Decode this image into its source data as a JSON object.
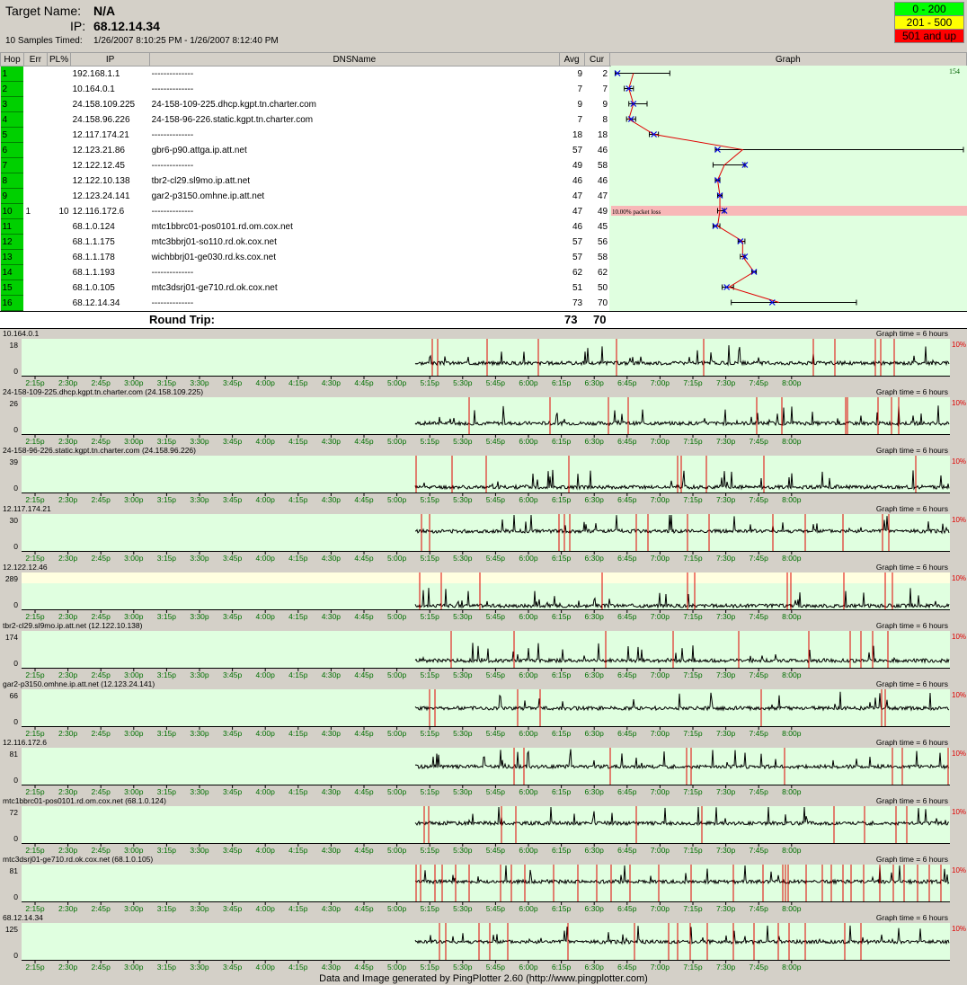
{
  "header": {
    "target_label": "Target Name:",
    "target_value": "N/A",
    "ip_label": "IP:",
    "ip_value": "68.12.14.34",
    "samples_label": "10 Samples Timed:",
    "samples_range": "1/26/2007 8:10:25 PM - 1/26/2007 8:12:40 PM"
  },
  "legend": [
    {
      "label": "0 - 200",
      "color": "#00ff00",
      "text_color": "#000000"
    },
    {
      "label": "201 - 500",
      "color": "#ffff00",
      "text_color": "#000000"
    },
    {
      "label": "501 and up",
      "color": "#ff0000",
      "text_color": "#000000"
    }
  ],
  "columns": {
    "hop": "Hop",
    "err": "Err",
    "pl": "PL%",
    "ip": "IP",
    "dns": "DNSName",
    "avg": "Avg",
    "cur": "Cur",
    "graph": "Graph"
  },
  "route_graph": {
    "max_label": "154",
    "packet_loss_note": "10.00% packet loss",
    "xmax": 154
  },
  "hops": [
    {
      "hop": "1",
      "err": "",
      "pl": "",
      "ip": "192.168.1.1",
      "dns": "--------------",
      "avg": "9",
      "cur": "2",
      "min": 1,
      "max": 25
    },
    {
      "hop": "2",
      "err": "",
      "pl": "",
      "ip": "10.164.0.1",
      "dns": "--------------",
      "avg": "7",
      "cur": "7",
      "min": 5,
      "max": 9
    },
    {
      "hop": "3",
      "err": "",
      "pl": "",
      "ip": "24.158.109.225",
      "dns": "24-158-109-225.dhcp.kgpt.tn.charter.com",
      "avg": "9",
      "cur": "9",
      "min": 7,
      "max": 15
    },
    {
      "hop": "4",
      "err": "",
      "pl": "",
      "ip": "24.158.96.226",
      "dns": "24-158-96-226.static.kgpt.tn.charter.com",
      "avg": "7",
      "cur": "8",
      "min": 6,
      "max": 10
    },
    {
      "hop": "5",
      "err": "",
      "pl": "",
      "ip": "12.117.174.21",
      "dns": "--------------",
      "avg": "18",
      "cur": "18",
      "min": 16,
      "max": 20
    },
    {
      "hop": "6",
      "err": "",
      "pl": "",
      "ip": "12.123.21.86",
      "dns": "gbr6-p90.attga.ip.att.net",
      "avg": "57",
      "cur": "46",
      "min": 45,
      "max": 154
    },
    {
      "hop": "7",
      "err": "",
      "pl": "",
      "ip": "12.122.12.45",
      "dns": "--------------",
      "avg": "49",
      "cur": "58",
      "min": 44,
      "max": 58
    },
    {
      "hop": "8",
      "err": "",
      "pl": "",
      "ip": "12.122.10.138",
      "dns": "tbr2-cl29.sl9mo.ip.att.net",
      "avg": "46",
      "cur": "46",
      "min": 45,
      "max": 47
    },
    {
      "hop": "9",
      "err": "",
      "pl": "",
      "ip": "12.123.24.141",
      "dns": "gar2-p3150.omhne.ip.att.net",
      "avg": "47",
      "cur": "47",
      "min": 46,
      "max": 48
    },
    {
      "hop": "10",
      "err": "1",
      "pl": "10",
      "ip": "12.116.172.6",
      "dns": "--------------",
      "avg": "47",
      "cur": "49",
      "min": 46,
      "max": 49
    },
    {
      "hop": "11",
      "err": "",
      "pl": "",
      "ip": "68.1.0.124",
      "dns": "mtc1bbrc01-pos0101.rd.om.cox.net",
      "avg": "46",
      "cur": "45",
      "min": 44,
      "max": 47
    },
    {
      "hop": "12",
      "err": "",
      "pl": "",
      "ip": "68.1.1.175",
      "dns": "mtc3bbrj01-so110.rd.ok.cox.net",
      "avg": "57",
      "cur": "56",
      "min": 55,
      "max": 58
    },
    {
      "hop": "13",
      "err": "",
      "pl": "",
      "ip": "68.1.1.178",
      "dns": "wichbbrj01-ge030.rd.ks.cox.net",
      "avg": "57",
      "cur": "58",
      "min": 56,
      "max": 58
    },
    {
      "hop": "14",
      "err": "",
      "pl": "",
      "ip": "68.1.1.193",
      "dns": "--------------",
      "avg": "62",
      "cur": "62",
      "min": 61,
      "max": 63
    },
    {
      "hop": "15",
      "err": "",
      "pl": "",
      "ip": "68.1.0.105",
      "dns": "mtc3dsrj01-ge710.rd.ok.cox.net",
      "avg": "51",
      "cur": "50",
      "min": 48,
      "max": 53
    },
    {
      "hop": "16",
      "err": "",
      "pl": "",
      "ip": "68.12.14.34",
      "dns": "--------------",
      "avg": "73",
      "cur": "70",
      "min": 52,
      "max": 107
    }
  ],
  "round_trip": {
    "label": "Round Trip:",
    "avg": "73",
    "cur": "70"
  },
  "time_axis": [
    "2:15p",
    "2:30p",
    "2:45p",
    "3:00p",
    "3:15p",
    "3:30p",
    "3:45p",
    "4:00p",
    "4:15p",
    "4:30p",
    "4:45p",
    "5:00p",
    "5:15p",
    "5:30p",
    "5:45p",
    "6:00p",
    "6:15p",
    "6:30p",
    "6:45p",
    "7:00p",
    "7:15p",
    "7:30p",
    "7:45p",
    "8:00p"
  ],
  "graph_time_label": "Graph time = 6 hours",
  "loss_scale_label": "10%",
  "timelines": [
    {
      "title": "10.164.0.1",
      "max": "18",
      "min": "0",
      "base": 0.3,
      "seed": 3,
      "loss": [
        481,
        487,
        542,
        599,
        686,
        783,
        905,
        929,
        974,
        980,
        995
      ]
    },
    {
      "title": "24-158-109-225.dhcp.kgpt.tn.charter.com (24.158.109.225)",
      "max": "26",
      "min": "0",
      "base": 0.25,
      "seed": 7,
      "loss": [
        522,
        612,
        677,
        699,
        842,
        870,
        941,
        943,
        977,
        992,
        1000
      ]
    },
    {
      "title": "24-158-96-226.static.kgpt.tn.charter.com (24.158.96.226)",
      "max": "39",
      "min": "0",
      "base": 0.1,
      "seed": 11,
      "loss": [
        463,
        503,
        541,
        633,
        754,
        758,
        786,
        850,
        1019
      ]
    },
    {
      "title": "12.117.174.21",
      "max": "30",
      "min": "0",
      "base": 0.5,
      "seed": 13,
      "loss": [
        469,
        478,
        622,
        628,
        634,
        708,
        721,
        765,
        789,
        860,
        896,
        938,
        982,
        989
      ]
    },
    {
      "title": "12.122.12.46",
      "max": "289",
      "min": "0",
      "base": 0.05,
      "seed": 17,
      "loss": [
        467,
        491,
        534,
        670,
        765,
        773,
        876,
        880,
        939,
        985,
        993
      ],
      "yellow_top": true
    },
    {
      "title": "tbr2-cl29.sl9mo.ip.att.net (12.122.10.138)",
      "max": "174",
      "min": "0",
      "base": 0.15,
      "seed": 19,
      "loss": [
        502,
        572,
        674,
        749,
        822,
        900,
        946,
        958,
        971,
        988
      ]
    },
    {
      "title": "gar2-p3150.omhne.ip.att.net (12.123.24.141)",
      "max": "66",
      "min": "0",
      "base": 0.45,
      "seed": 23,
      "loss": [
        478,
        484,
        576,
        601,
        847,
        981,
        985
      ]
    },
    {
      "title": "12.116.172.6",
      "max": "81",
      "min": "0",
      "base": 0.45,
      "seed": 29,
      "loss": [
        572,
        583,
        679,
        764,
        769,
        873,
        993,
        1004,
        1055
      ]
    },
    {
      "title": "mtc1bbrc01-pos0101.rd.om.cox.net (68.1.0.124)",
      "max": "72",
      "min": "0",
      "base": 0.5,
      "seed": 31,
      "loss": [
        472,
        477,
        558,
        574,
        708,
        781,
        928,
        962,
        997,
        1009
      ]
    },
    {
      "title": "mtc3dsrj01-ge710.rd.ok.cox.net (68.1.0.105)",
      "max": "81",
      "min": "0",
      "base": 0.5,
      "seed": 37,
      "loss": [
        463,
        468,
        484,
        492,
        507,
        522,
        557,
        569,
        584,
        616,
        643,
        664,
        680,
        701,
        733,
        769,
        816,
        849,
        871,
        874,
        877,
        897,
        915,
        925,
        938,
        947,
        961,
        979,
        994,
        1006,
        1021,
        1034,
        1047
      ]
    },
    {
      "title": "68.12.14.34",
      "max": "125",
      "min": "0",
      "base": 0.45,
      "seed": 41,
      "loss": [
        489,
        496,
        533,
        545,
        565,
        632,
        706,
        744,
        754,
        768,
        787,
        816,
        839,
        866,
        878,
        896,
        940,
        958
      ]
    }
  ],
  "footer": "Data and Image generated by PingPlotter 2.60 (http://www.pingplotter.com)"
}
